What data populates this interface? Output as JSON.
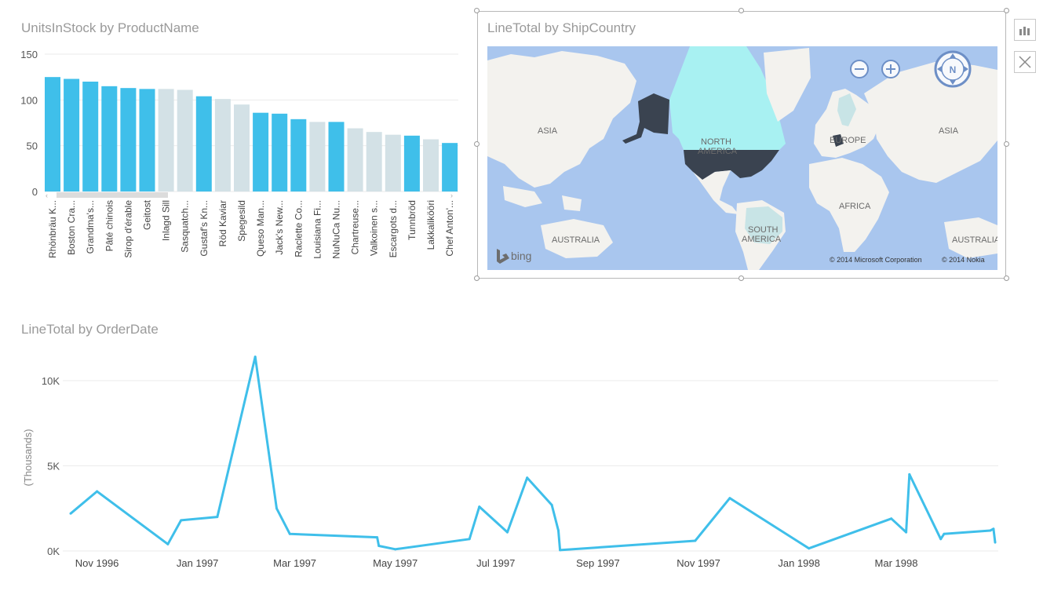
{
  "bar_chart": {
    "title": "UnitsInStock by ProductName",
    "y_ticks": [
      "150",
      "100",
      "50",
      "0"
    ],
    "colors": {
      "highlight": "#3fbfea",
      "dim": "#d3e1e6",
      "grid": "#ebebeb"
    }
  },
  "map": {
    "title": "LineTotal by ShipCountry",
    "labels": {
      "asia_left": "ASIA",
      "asia_right": "ASIA",
      "north_america": "NORTH\nAMERICA",
      "europe": "EUROPE",
      "africa": "AFRICA",
      "south_america": "SOUTH\nAMERICA",
      "australia_left": "AUSTRALIA",
      "australia_right": "AUSTRALIA"
    },
    "bing_label": "bing",
    "copyright_ms": "© 2014 Microsoft Corporation",
    "copyright_nokia": "© 2014 Nokia",
    "compass_label": "N",
    "colors": {
      "ocean": "#a9c6ee",
      "land": "#f3f2ee",
      "highlight": "#3a4350",
      "light": "#a8f1f2"
    }
  },
  "line_chart": {
    "title": "LineTotal by OrderDate",
    "y_axis_label": "(Thousands)",
    "y_ticks": [
      "10K",
      "5K",
      "0K"
    ],
    "color": "#3fbfea"
  },
  "side_buttons": {
    "chart_icon": "bar-chart-icon",
    "close_icon": "close-icon"
  },
  "chart_data": [
    {
      "type": "bar",
      "title": "UnitsInStock by ProductName",
      "categories": [
        "Rhönbräu K...",
        "Boston Cra...",
        "Grandma's...",
        "Pâté chinois",
        "Sirop d'érable",
        "Geitost",
        "Inlagd Sill",
        "Sasquatch...",
        "Gustaf's Kn...",
        "Röd Kaviar",
        "Spegesild",
        "Queso Man...",
        "Jack's New...",
        "Raclette Co...",
        "Louisiana Fi...",
        "NuNuCa Nu...",
        "Chartreuse...",
        "Valkoinen s...",
        "Escargots d...",
        "Tunnbröd",
        "Lakkalikööri",
        "Chef Anton'..."
      ],
      "values": [
        125,
        123,
        120,
        115,
        113,
        112,
        112,
        111,
        104,
        101,
        95,
        86,
        85,
        79,
        76,
        76,
        69,
        65,
        62,
        61,
        57,
        53
      ],
      "highlighted": [
        true,
        true,
        true,
        true,
        true,
        true,
        false,
        false,
        true,
        false,
        false,
        true,
        true,
        true,
        false,
        true,
        false,
        false,
        false,
        true,
        false,
        true
      ],
      "ylim": [
        0,
        150
      ],
      "grid": true
    },
    {
      "type": "line",
      "title": "LineTotal by OrderDate",
      "ylabel": "(Thousands)",
      "x": [
        "1996-10-16",
        "1996-11-01",
        "1996-12-14",
        "1996-12-22",
        "1997-01-13",
        "1997-02-05",
        "1997-02-18",
        "1997-02-26",
        "1997-04-20",
        "1997-04-21",
        "1997-05-01",
        "1997-06-15",
        "1997-06-21",
        "1997-07-08",
        "1997-07-20",
        "1997-08-04",
        "1997-08-08",
        "1997-08-09",
        "1997-10-30",
        "1997-11-20",
        "1998-01-07",
        "1998-02-26",
        "1998-03-07",
        "1998-03-09",
        "1998-03-28",
        "1998-03-30",
        "1998-04-27",
        "1998-04-29",
        "1998-04-30"
      ],
      "y": [
        2.2,
        3.5,
        0.4,
        1.8,
        2.0,
        11.4,
        2.5,
        1.0,
        0.8,
        0.3,
        0.1,
        0.7,
        2.6,
        1.1,
        4.3,
        2.7,
        1.2,
        0.05,
        0.6,
        3.1,
        0.15,
        1.9,
        1.1,
        4.5,
        0.7,
        1.0,
        1.2,
        1.3,
        0.5
      ],
      "x_ticks": [
        "Nov 1996",
        "Jan 1997",
        "Mar 1997",
        "May 1997",
        "Jul 1997",
        "Sep 1997",
        "Nov 1997",
        "Jan 1998",
        "Mar 1998"
      ],
      "ylim": [
        0,
        12
      ],
      "grid": true
    }
  ]
}
